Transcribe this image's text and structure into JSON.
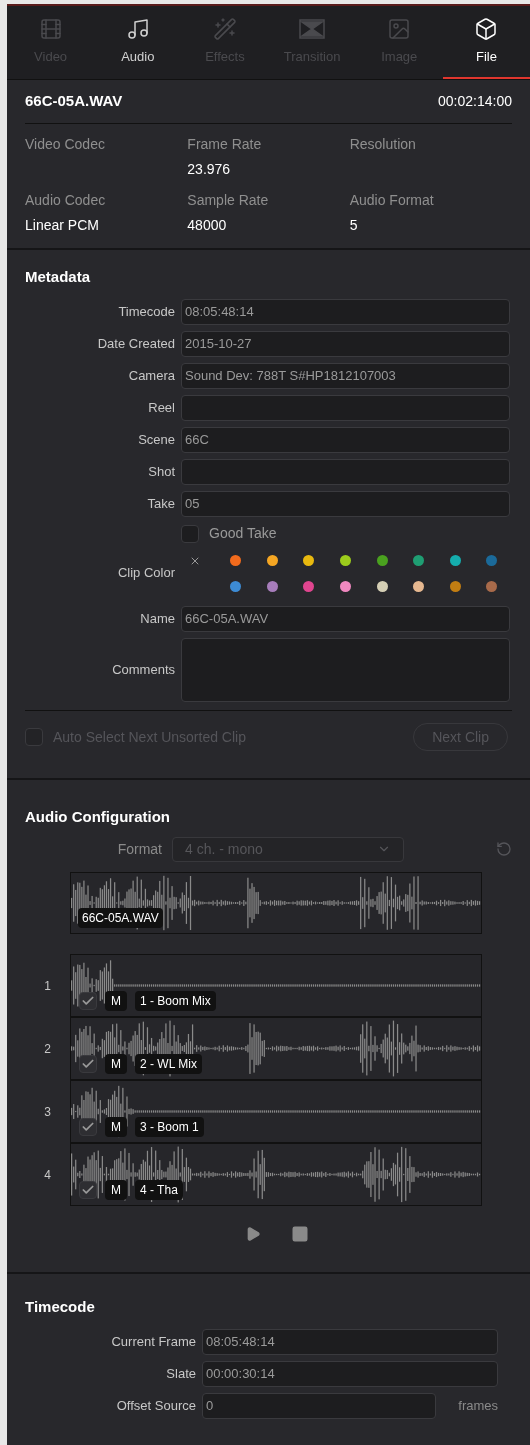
{
  "tabs": [
    {
      "label": "Video",
      "selected": false,
      "disabled": true
    },
    {
      "label": "Audio",
      "selected": false,
      "disabled": false
    },
    {
      "label": "Effects",
      "selected": false,
      "disabled": true
    },
    {
      "label": "Transition",
      "selected": false,
      "disabled": true
    },
    {
      "label": "Image",
      "selected": false,
      "disabled": true
    },
    {
      "label": "File",
      "selected": true,
      "disabled": false
    }
  ],
  "clip": {
    "name": "66C-05A.WAV",
    "duration": "00:02:14:00"
  },
  "info": [
    {
      "label": "Video Codec"
    },
    {
      "label": "Frame Rate",
      "value": "23.976"
    },
    {
      "label": "Resolution"
    },
    {
      "label": "Audio Codec",
      "value": "Linear PCM"
    },
    {
      "label": "Sample Rate",
      "value": "48000"
    },
    {
      "label": "Audio Format",
      "value": "5"
    }
  ],
  "metadata": {
    "title": "Metadata",
    "fields": [
      {
        "label": "Timecode",
        "value": "08:05:48:14"
      },
      {
        "label": "Date Created",
        "value": "2015-10-27"
      },
      {
        "label": "Camera",
        "value": "Sound Dev: 788T S#HP1812107003"
      },
      {
        "label": "Reel"
      },
      {
        "label": "Scene",
        "value": "66C"
      },
      {
        "label": "Shot"
      },
      {
        "label": "Take",
        "value": "05"
      }
    ],
    "good_take": {
      "label": "Good Take",
      "checked": false
    },
    "clip_color": {
      "label": "Clip Color",
      "colors": [
        {
          "color": "#f26b1d"
        },
        {
          "color": "#f5a623"
        },
        {
          "color": "#e8b90f"
        },
        {
          "color": "#9ccc1c"
        },
        {
          "color": "#4aa11f"
        },
        {
          "color": "#1f9e73"
        },
        {
          "color": "#15adad"
        },
        {
          "color": "#1b6a9a"
        },
        {
          "color": "#3d8bd4"
        },
        {
          "color": "#a77dbb"
        },
        {
          "color": "#e0458f"
        },
        {
          "color": "#f088c0"
        },
        {
          "color": "#d5cfb5"
        },
        {
          "color": "#e6b890"
        },
        {
          "color": "#c27d12"
        },
        {
          "color": "#a86a4a"
        }
      ]
    },
    "name": {
      "label": "Name",
      "value": "66C-05A.WAV"
    },
    "comments": {
      "label": "Comments"
    },
    "auto_select": {
      "label": "Auto Select Next Unsorted Clip",
      "checked": false,
      "disabled": true
    },
    "next_clip": {
      "label": "Next Clip",
      "disabled": true
    }
  },
  "audio_config": {
    "title": "Audio Configuration",
    "format_label": "Format",
    "format_value": "4 ch. - mono",
    "format_disabled": true,
    "source_label": "66C-05A.WAV",
    "channels": [
      {
        "number": "1",
        "mute": "M",
        "name": "1 - Boom Mix",
        "checked": true
      },
      {
        "number": "2",
        "mute": "M",
        "name": "2 - WL Mix",
        "checked": true
      },
      {
        "number": "3",
        "mute": "M",
        "name": "3 - Boom 1",
        "checked": true
      },
      {
        "number": "4",
        "mute": "M",
        "name": "4 - Tha",
        "checked": true
      }
    ]
  },
  "timecode": {
    "title": "Timecode",
    "fields": [
      {
        "label": "Current Frame",
        "value": "08:05:48:14"
      },
      {
        "label": "Slate",
        "value": "00:00:30:14"
      },
      {
        "label": "Offset Source",
        "value": "0",
        "unit": "frames"
      }
    ]
  }
}
